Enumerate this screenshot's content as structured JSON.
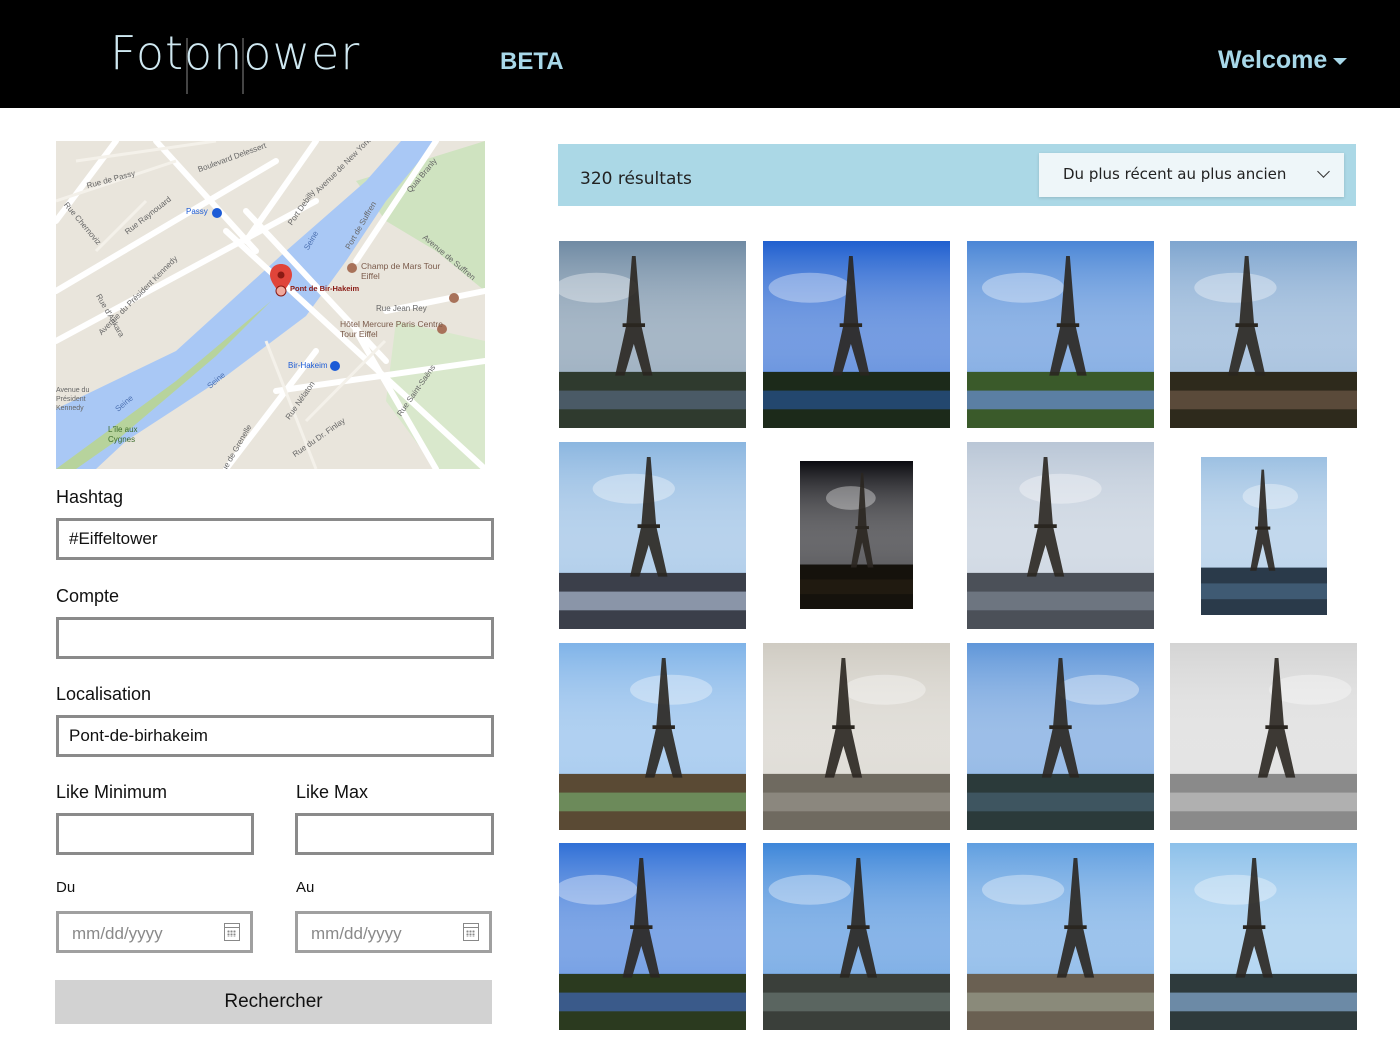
{
  "header": {
    "logo_text": "Fotonower",
    "beta_label": "BETA",
    "welcome_label": "Welcome",
    "welcome_icon": "caret-down-icon"
  },
  "map": {
    "streets": [
      "Boulevard Delessert",
      "Rue de Passy",
      "Rue Raynouard",
      "Rue Chernoviz",
      "Avenue du Président Kennedy",
      "Rue d'Ankara",
      "Port Debilly",
      "Port de Suffren",
      "Quai Branly",
      "Avenue de Suffren",
      "Rue Jean Rey",
      "Avenue de New York",
      "Rue Nélaton",
      "Rue du Dr. Finlay",
      "Rue Saint-Saëns",
      "Rue de Grenelle"
    ],
    "places": [
      "Passy",
      "Champ de Mars Tour Eiffel",
      "Hôtel Mercure Paris Centre Tour Eiffel",
      "Bir-Hakeim",
      "L'île aux Cygnes",
      "Avenue du Président Kennedy"
    ],
    "river_labels": [
      "Seine",
      "Seine",
      "Seine"
    ],
    "pin_label": "Pont de Bir-Hakeim"
  },
  "form": {
    "hashtag": {
      "label": "Hashtag",
      "value": "#Eiffeltower"
    },
    "compte": {
      "label": "Compte",
      "value": ""
    },
    "localisation": {
      "label": "Localisation",
      "value": "Pont-de-birhakeim"
    },
    "like_min": {
      "label": "Like Minimum",
      "value": ""
    },
    "like_max": {
      "label": "Like Max",
      "value": ""
    },
    "du": {
      "label": "Du",
      "placeholder": "mm/dd/yyyy"
    },
    "au": {
      "label": "Au",
      "placeholder": "mm/dd/yyyy"
    },
    "submit_label": "Rechercher"
  },
  "results": {
    "count_label": "320 résultats",
    "sort_selected": "Du plus récent au plus ancien"
  },
  "photos": [
    {
      "sky": "#6f8aa3",
      "ground": "#2f3a2e",
      "water": "#4a5a66"
    },
    {
      "sky": "#1f5fcf",
      "ground": "#1c2a1a",
      "water": "#23476e"
    },
    {
      "sky": "#4a86d6",
      "ground": "#3a5a2a",
      "water": "#5b7fa3"
    },
    {
      "sky": "#7ea5cf",
      "ground": "#2e2a1c",
      "water": "#5a4a3a"
    },
    {
      "sky": "#8bb6e0",
      "ground": "#3b3f4a",
      "water": "#8a95a8"
    },
    {
      "sky": "#0b0b10",
      "ground": "#15120c",
      "water": "#201a10"
    },
    {
      "sky": "#b9c6d6",
      "ground": "#4b5058",
      "water": "#6d7580"
    },
    {
      "sky": "#9cc0e2",
      "ground": "#2a3a4a",
      "water": "#3f5a73"
    },
    {
      "sky": "#7fb3e8",
      "ground": "#5a4a34",
      "water": "#6c8a5a"
    },
    {
      "sky": "#cfcbc2",
      "ground": "#6f6a60",
      "water": "#8b877e"
    },
    {
      "sky": "#5f96d9",
      "ground": "#2b3a3a",
      "water": "#3e5560"
    },
    {
      "sky": "#d4d4d4",
      "ground": "#8a8a8a",
      "water": "#b0b0b0"
    },
    {
      "sky": "#2f6fd6",
      "ground": "#2b3a1f",
      "water": "#3a5a8a"
    },
    {
      "sky": "#3d86d9",
      "ground": "#3a3f3a",
      "water": "#5a6560"
    },
    {
      "sky": "#5f9ee0",
      "ground": "#6a6052",
      "water": "#8a8a7a"
    },
    {
      "sky": "#8cc0ea",
      "ground": "#2e3a3c",
      "water": "#6c8aa6"
    }
  ]
}
